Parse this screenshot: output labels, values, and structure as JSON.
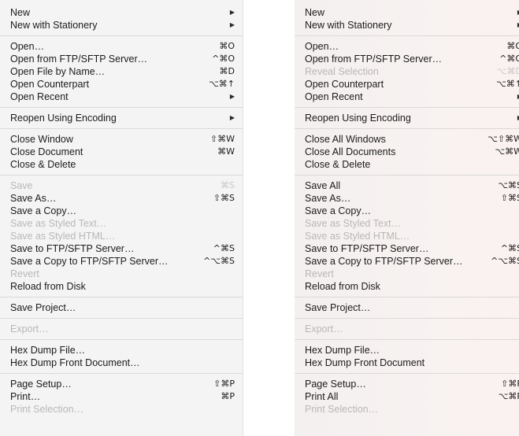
{
  "menus": [
    {
      "sections": [
        [
          {
            "label": "New",
            "shortcut": "▶",
            "disabled": false,
            "sub": true
          },
          {
            "label": "New with Stationery",
            "shortcut": "▶",
            "disabled": false,
            "sub": true
          }
        ],
        [
          {
            "label": "Open…",
            "shortcut": "⌘O",
            "disabled": false
          },
          {
            "label": "Open from FTP/SFTP Server…",
            "shortcut": "^⌘O",
            "disabled": false
          },
          {
            "label": "Open File by Name…",
            "shortcut": "⌘D",
            "disabled": false
          },
          {
            "label": "Open Counterpart",
            "shortcut": "⌥⌘↑",
            "disabled": false
          },
          {
            "label": "Open Recent",
            "shortcut": "▶",
            "disabled": false,
            "sub": true
          }
        ],
        [
          {
            "label": "Reopen Using Encoding",
            "shortcut": "▶",
            "disabled": false,
            "sub": true
          }
        ],
        [
          {
            "label": "Close Window",
            "shortcut": "⇧⌘W",
            "disabled": false
          },
          {
            "label": "Close Document",
            "shortcut": "⌘W",
            "disabled": false
          },
          {
            "label": "Close & Delete",
            "shortcut": "",
            "disabled": false
          }
        ],
        [
          {
            "label": "Save",
            "shortcut": "⌘S",
            "disabled": true
          },
          {
            "label": "Save As…",
            "shortcut": "⇧⌘S",
            "disabled": false
          },
          {
            "label": "Save a Copy…",
            "shortcut": "",
            "disabled": false
          },
          {
            "label": "Save as Styled Text…",
            "shortcut": "",
            "disabled": true
          },
          {
            "label": "Save as Styled HTML…",
            "shortcut": "",
            "disabled": true
          },
          {
            "label": "Save to FTP/SFTP Server…",
            "shortcut": "^⌘S",
            "disabled": false
          },
          {
            "label": "Save a Copy to FTP/SFTP Server…",
            "shortcut": "^⌥⌘S",
            "disabled": false
          },
          {
            "label": "Revert",
            "shortcut": "",
            "disabled": true
          },
          {
            "label": "Reload from Disk",
            "shortcut": "",
            "disabled": false
          }
        ],
        [
          {
            "label": "Save Project…",
            "shortcut": "",
            "disabled": false
          }
        ],
        [
          {
            "label": "Export…",
            "shortcut": "",
            "disabled": true
          }
        ],
        [
          {
            "label": "Hex Dump File…",
            "shortcut": "",
            "disabled": false
          },
          {
            "label": "Hex Dump Front Document…",
            "shortcut": "",
            "disabled": false
          }
        ],
        [
          {
            "label": "Page Setup…",
            "shortcut": "⇧⌘P",
            "disabled": false
          },
          {
            "label": "Print…",
            "shortcut": "⌘P",
            "disabled": false
          },
          {
            "label": "Print Selection…",
            "shortcut": "",
            "disabled": true
          }
        ]
      ]
    },
    {
      "sections": [
        [
          {
            "label": "New",
            "shortcut": "▶",
            "disabled": false,
            "sub": true
          },
          {
            "label": "New with Stationery",
            "shortcut": "▶",
            "disabled": false,
            "sub": true
          }
        ],
        [
          {
            "label": "Open…",
            "shortcut": "⌘O",
            "disabled": false
          },
          {
            "label": "Open from FTP/SFTP Server…",
            "shortcut": "^⌘O",
            "disabled": false
          },
          {
            "label": "Reveal Selection",
            "shortcut": "⌥⌘D",
            "disabled": true
          },
          {
            "label": "Open Counterpart",
            "shortcut": "⌥⌘↑",
            "disabled": false
          },
          {
            "label": "Open Recent",
            "shortcut": "▶",
            "disabled": false,
            "sub": true
          }
        ],
        [
          {
            "label": "Reopen Using Encoding",
            "shortcut": "▶",
            "disabled": false,
            "sub": true
          }
        ],
        [
          {
            "label": "Close All Windows",
            "shortcut": "⌥⇧⌘W",
            "disabled": false
          },
          {
            "label": "Close All Documents",
            "shortcut": "⌥⌘W",
            "disabled": false
          },
          {
            "label": "Close & Delete",
            "shortcut": "",
            "disabled": false
          }
        ],
        [
          {
            "label": "Save All",
            "shortcut": "⌥⌘S",
            "disabled": false
          },
          {
            "label": "Save As…",
            "shortcut": "⇧⌘S",
            "disabled": false
          },
          {
            "label": "Save a Copy…",
            "shortcut": "",
            "disabled": false
          },
          {
            "label": "Save as Styled Text…",
            "shortcut": "",
            "disabled": true
          },
          {
            "label": "Save as Styled HTML…",
            "shortcut": "",
            "disabled": true
          },
          {
            "label": "Save to FTP/SFTP Server…",
            "shortcut": "^⌘S",
            "disabled": false
          },
          {
            "label": "Save a Copy to FTP/SFTP Server…",
            "shortcut": "^⌥⌘S",
            "disabled": false
          },
          {
            "label": "Revert",
            "shortcut": "",
            "disabled": true
          },
          {
            "label": "Reload from Disk",
            "shortcut": "",
            "disabled": false
          }
        ],
        [
          {
            "label": "Save Project…",
            "shortcut": "",
            "disabled": false
          }
        ],
        [
          {
            "label": "Export…",
            "shortcut": "",
            "disabled": true
          }
        ],
        [
          {
            "label": "Hex Dump File…",
            "shortcut": "",
            "disabled": false
          },
          {
            "label": "Hex Dump Front Document",
            "shortcut": "",
            "disabled": false
          }
        ],
        [
          {
            "label": "Page Setup…",
            "shortcut": "⇧⌘P",
            "disabled": false
          },
          {
            "label": "Print All",
            "shortcut": "⌥⌘P",
            "disabled": false
          },
          {
            "label": "Print Selection…",
            "shortcut": "",
            "disabled": true
          }
        ]
      ]
    }
  ]
}
